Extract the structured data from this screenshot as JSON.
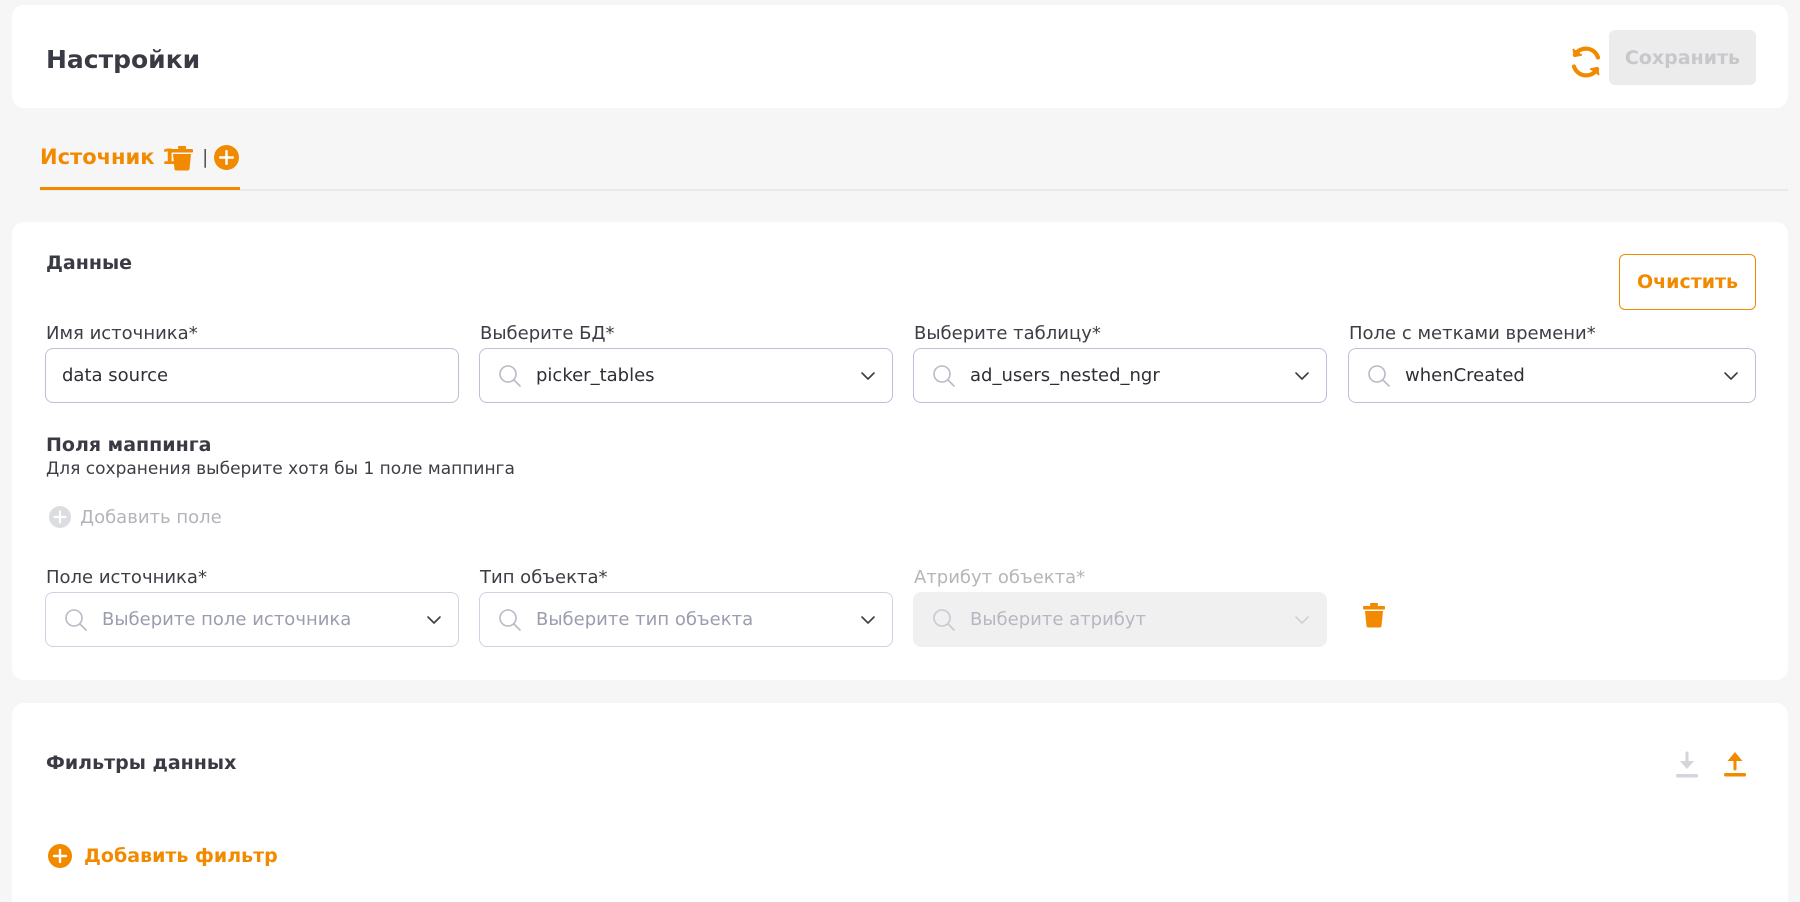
{
  "header": {
    "title": "Настройки",
    "save_label": "Сохранить"
  },
  "tabs": [
    {
      "label": "Источник 1",
      "active": true
    }
  ],
  "tab_separator": "|",
  "data_section": {
    "title": "Данные",
    "clear_label": "Очистить",
    "fields": {
      "source_name": {
        "label": "Имя источника*",
        "value": "data source"
      },
      "database": {
        "label": "Выберите БД*",
        "value": "picker_tables"
      },
      "table": {
        "label": "Выберите таблицу*",
        "value": "ad_users_nested_ngr"
      },
      "timestamp": {
        "label": "Поле с метками времени*",
        "value": "whenCreated"
      }
    }
  },
  "mapping": {
    "title": "Поля маппинга",
    "hint": "Для сохранения выберите хотя бы 1 поле маппинга",
    "add_field_label": "Добавить поле",
    "row": {
      "source_field": {
        "label": "Поле источника*",
        "placeholder": "Выберите поле источника"
      },
      "object_type": {
        "label": "Тип объекта*",
        "placeholder": "Выберите тип объекта"
      },
      "object_attribute": {
        "label": "Атрибут объекта*",
        "placeholder": "Выберите атрибут",
        "disabled": true
      }
    }
  },
  "filters": {
    "title": "Фильтры данных",
    "add_filter_label": "Добавить фильтр"
  },
  "icons": {
    "refresh": "refresh-icon",
    "trash": "trash-icon",
    "add": "plus-circle-icon",
    "search": "search-icon",
    "chevron": "chevron-down-icon",
    "download": "download-icon",
    "upload": "upload-icon"
  },
  "colors": {
    "accent": "#f28a00",
    "disabled_text": "#c7c7cc",
    "disabled_bg": "#ececec",
    "page_bg": "#f6f6f7"
  }
}
